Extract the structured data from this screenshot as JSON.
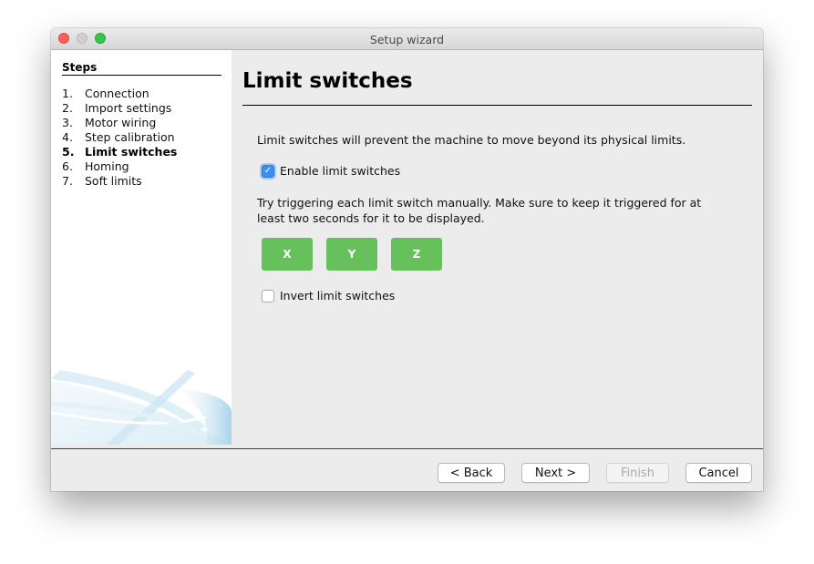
{
  "window": {
    "title": "Setup wizard"
  },
  "sidebar": {
    "heading": "Steps",
    "steps": [
      {
        "num": "1.",
        "label": "Connection",
        "active": false
      },
      {
        "num": "2.",
        "label": "Import settings",
        "active": false
      },
      {
        "num": "3.",
        "label": "Motor wiring",
        "active": false
      },
      {
        "num": "4.",
        "label": "Step calibration",
        "active": false
      },
      {
        "num": "5.",
        "label": "Limit switches",
        "active": true
      },
      {
        "num": "6.",
        "label": "Homing",
        "active": false
      },
      {
        "num": "7.",
        "label": "Soft limits",
        "active": false
      }
    ]
  },
  "main": {
    "title": "Limit switches",
    "description": "Limit switches will prevent the machine to move beyond its physical limits.",
    "enable_checkbox": {
      "label": "Enable limit switches",
      "checked": true
    },
    "hint": "Try triggering each limit switch manually. Make sure to keep it triggered for at least two seconds for it to be displayed.",
    "axis_indicators": [
      {
        "label": "X",
        "color": "#66c15c"
      },
      {
        "label": "Y",
        "color": "#66c15c"
      },
      {
        "label": "Z",
        "color": "#66c15c"
      }
    ],
    "invert_checkbox": {
      "label": "Invert limit switches",
      "checked": false
    }
  },
  "footer": {
    "back_label": "< Back",
    "next_label": "Next >",
    "finish_label": "Finish",
    "finish_enabled": false,
    "cancel_label": "Cancel"
  }
}
